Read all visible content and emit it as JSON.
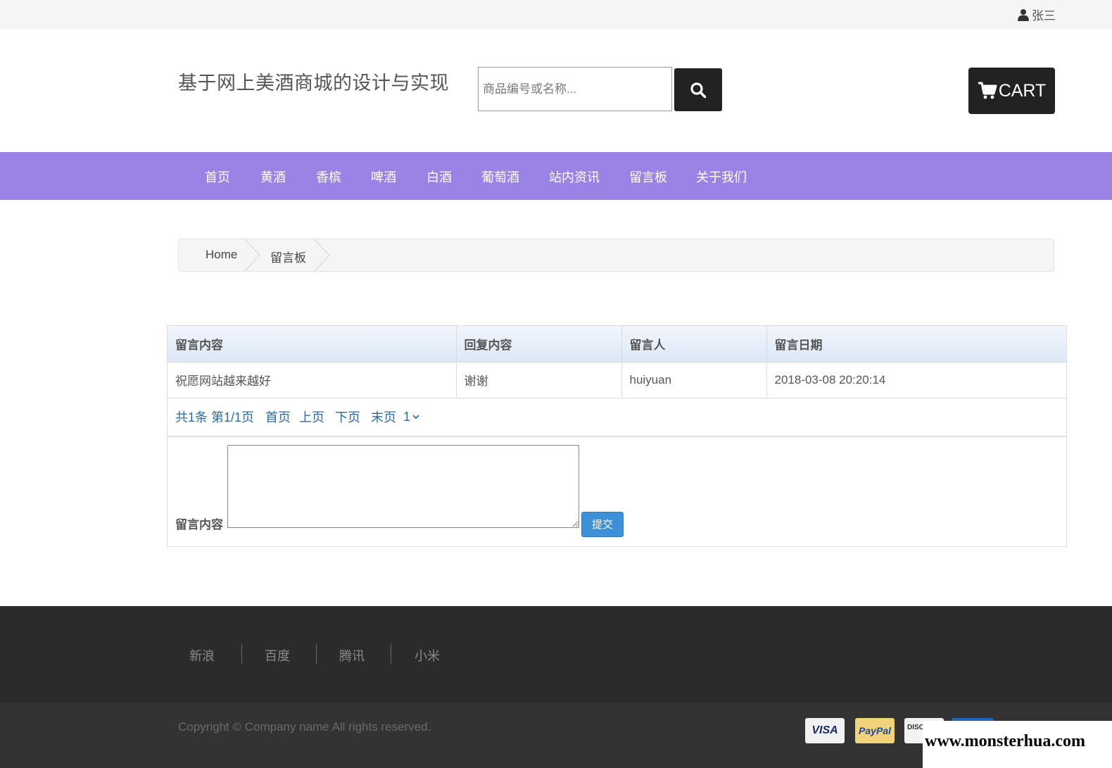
{
  "topbar": {
    "user_name": "张三",
    "user_icon": "user-icon"
  },
  "header": {
    "site_title": "基于网上美酒商城的设计与实现",
    "search_placeholder": "商品编号或名称...",
    "search_icon": "search-icon",
    "cart_label": "CART",
    "cart_icon": "cart-icon",
    "colors": {
      "button_bg": "#222222",
      "nav_bg": "#9b82e5"
    }
  },
  "nav": {
    "items": [
      {
        "label": "首页"
      },
      {
        "label": "黄酒"
      },
      {
        "label": "香槟"
      },
      {
        "label": "啤酒"
      },
      {
        "label": "白酒"
      },
      {
        "label": "葡萄酒"
      },
      {
        "label": "站内资讯"
      },
      {
        "label": "留言板"
      },
      {
        "label": "关于我们"
      }
    ]
  },
  "breadcrumb": {
    "home": "Home",
    "current": "留言板"
  },
  "messages": {
    "columns": [
      "留言内容",
      "回复内容",
      "留言人",
      "留言日期"
    ],
    "rows": [
      {
        "content": "祝愿网站越来越好",
        "reply": "谢谢",
        "author": "huiyuan",
        "date": "2018-03-08 20:20:14"
      }
    ],
    "pager": {
      "summary": "共1条 第1/1页",
      "first": "首页",
      "prev": "上页",
      "next": "下页",
      "last": "末页",
      "page_select": "1"
    }
  },
  "form": {
    "label": "留言内容",
    "submit_label": "提交",
    "textarea_value": ""
  },
  "footer": {
    "links": [
      {
        "label": "新浪"
      },
      {
        "label": "百度"
      },
      {
        "label": "腾讯"
      },
      {
        "label": "小米"
      }
    ],
    "copyright": "Copyright © Company name All rights reserved.",
    "payments": [
      {
        "label": "VISA"
      },
      {
        "label": "PayPal"
      },
      {
        "label": "DISC"
      }
    ]
  },
  "watermark": "www.monsterhua.com"
}
